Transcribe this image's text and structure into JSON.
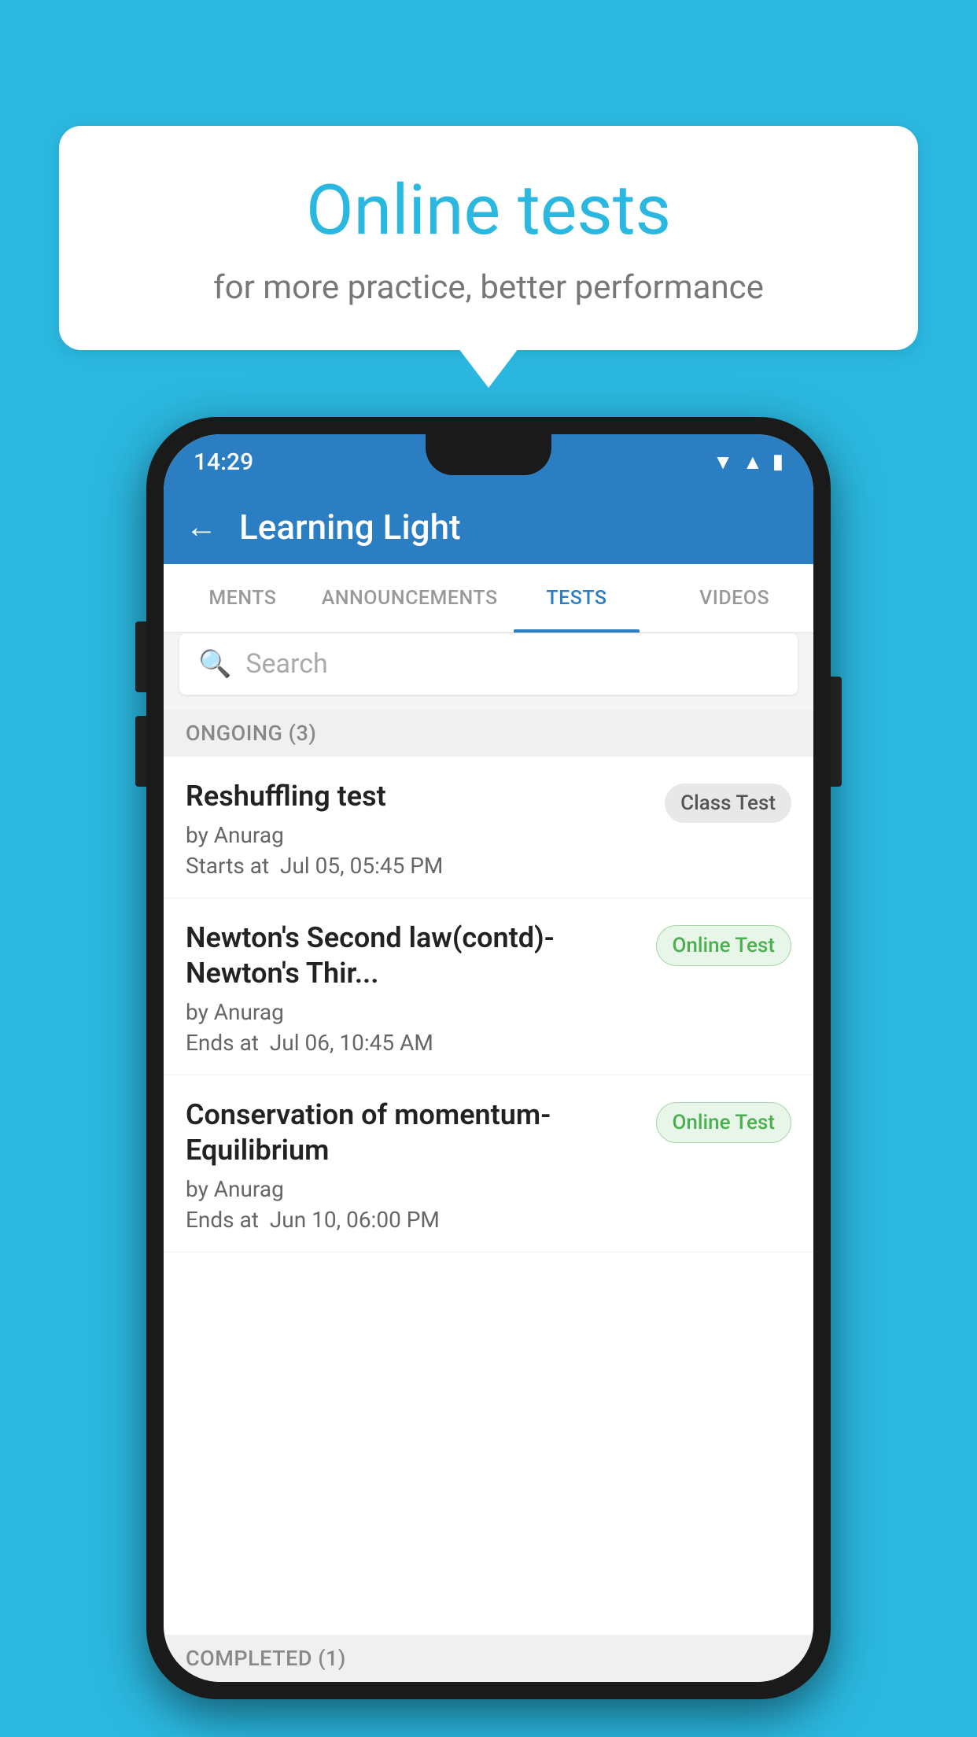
{
  "background_color": "#2BB8E0",
  "speech_bubble": {
    "title": "Online tests",
    "subtitle": "for more practice, better performance"
  },
  "phone": {
    "status_bar": {
      "time": "14:29",
      "icons": [
        "wifi",
        "signal",
        "battery"
      ]
    },
    "header": {
      "back_label": "←",
      "title": "Learning Light"
    },
    "tabs": [
      {
        "label": "MENTS",
        "active": false
      },
      {
        "label": "ANNOUNCEMENTS",
        "active": false
      },
      {
        "label": "TESTS",
        "active": true
      },
      {
        "label": "VIDEOS",
        "active": false
      }
    ],
    "search": {
      "placeholder": "Search"
    },
    "ongoing_section": {
      "label": "ONGOING (3)"
    },
    "test_items": [
      {
        "name": "Reshuffling test",
        "author": "by Anurag",
        "time_label": "Starts at",
        "time": "Jul 05, 05:45 PM",
        "badge": "Class Test",
        "badge_type": "class"
      },
      {
        "name": "Newton's Second law(contd)-Newton's Thir...",
        "author": "by Anurag",
        "time_label": "Ends at",
        "time": "Jul 06, 10:45 AM",
        "badge": "Online Test",
        "badge_type": "online"
      },
      {
        "name": "Conservation of momentum-Equilibrium",
        "author": "by Anurag",
        "time_label": "Ends at",
        "time": "Jun 10, 06:00 PM",
        "badge": "Online Test",
        "badge_type": "online"
      }
    ],
    "completed_section": {
      "label": "COMPLETED (1)"
    }
  }
}
